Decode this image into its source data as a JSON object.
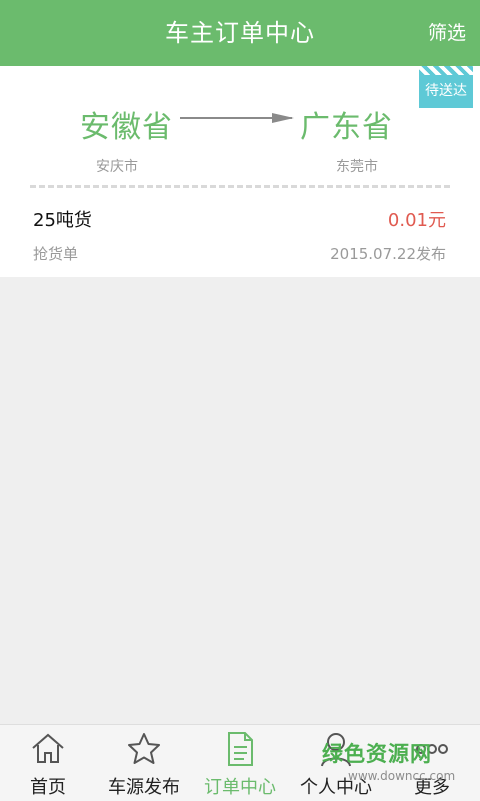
{
  "header": {
    "title": "车主订单中心",
    "filter_label": "筛选"
  },
  "order": {
    "status_badge": "待送达",
    "from_province": "安徽省",
    "to_province": "广东省",
    "from_city": "安庆市",
    "to_city": "东莞市",
    "goods": "25吨货",
    "price": "0.01元",
    "order_type": "抢货单",
    "published": "2015.07.22发布"
  },
  "tabbar": {
    "items": [
      {
        "label": "首页",
        "icon": "home-icon"
      },
      {
        "label": "车源发布",
        "icon": "star-icon"
      },
      {
        "label": "订单中心",
        "icon": "document-icon",
        "active": true
      },
      {
        "label": "个人中心",
        "icon": "person-icon"
      },
      {
        "label": "更多",
        "icon": "more-icon"
      }
    ]
  },
  "watermark": {
    "text": "绿色资源网",
    "url_text": "www.downcc.com"
  },
  "colors": {
    "accent": "#6bbb6d",
    "badge": "#5ec9d6",
    "price": "#e05a50"
  }
}
